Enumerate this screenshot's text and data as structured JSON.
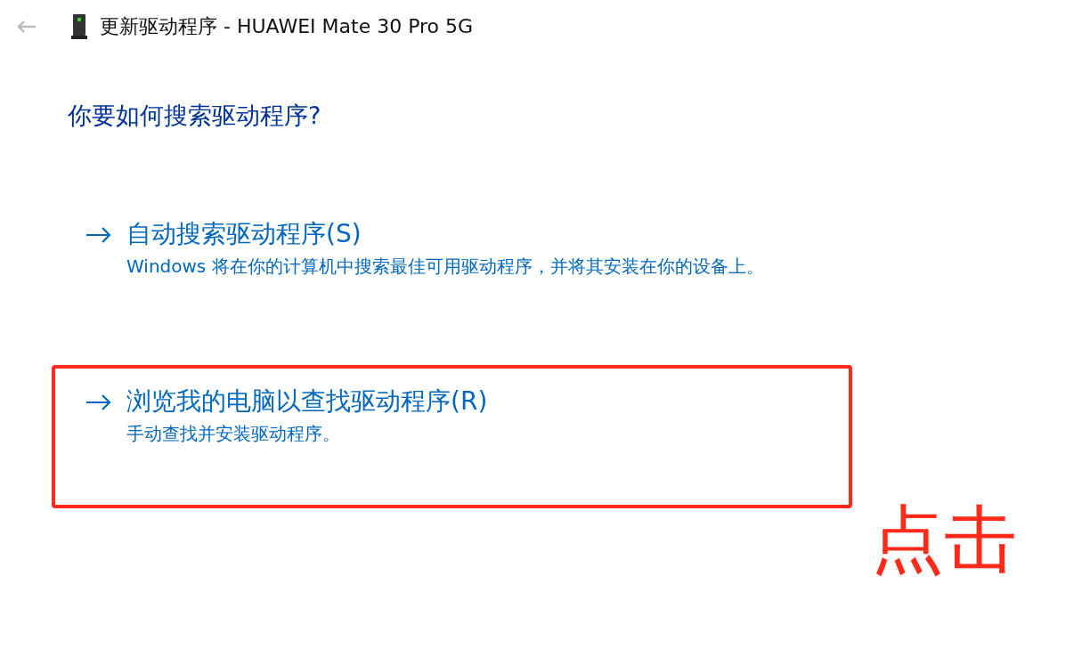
{
  "window": {
    "title": "更新驱动程序 - HUAWEI Mate 30 Pro 5G",
    "back_disabled": true
  },
  "heading": "你要如何搜索驱动程序?",
  "options": [
    {
      "title": "自动搜索驱动程序(S)",
      "description": "Windows 将在你的计算机中搜索最佳可用驱动程序，并将其安装在你的设备上。",
      "highlighted": false
    },
    {
      "title": "浏览我的电脑以查找驱动程序(R)",
      "description": "手动查找并安装驱动程序。",
      "highlighted": true
    }
  ],
  "annotation": {
    "text": "点击"
  }
}
